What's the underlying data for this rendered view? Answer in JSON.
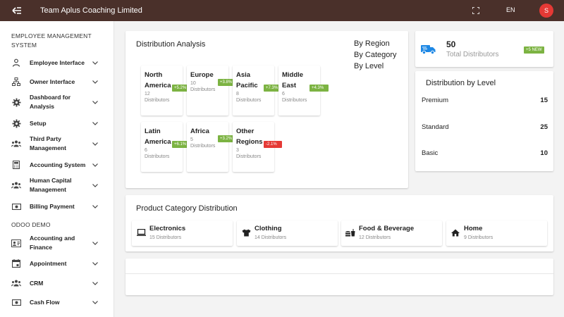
{
  "header": {
    "title": "Team Aplus Coaching Limited",
    "language": "EN",
    "avatar_initial": "S"
  },
  "sidebar": {
    "section1": "EMPLOYEE MANAGEMENT SYSTEM",
    "items1": [
      {
        "label": "Employee Interface",
        "icon": "person-icon"
      },
      {
        "label": "Owner Interface",
        "icon": "org-chart-icon"
      },
      {
        "label": "Dashboard for Analysis",
        "icon": "gear-icon"
      },
      {
        "label": "Setup",
        "icon": "gear-icon"
      },
      {
        "label": "Third Party Management",
        "icon": "group-icon"
      },
      {
        "label": "Accounting System",
        "icon": "calculator-icon"
      },
      {
        "label": "Human Capital Management",
        "icon": "group-icon"
      },
      {
        "label": "Billing Payment",
        "icon": "money-icon"
      }
    ],
    "section2": "ODOO DEMO",
    "items2": [
      {
        "label": "Accounting and Finance",
        "icon": "contact-card-icon"
      },
      {
        "label": "Appointment",
        "icon": "calendar-icon"
      },
      {
        "label": "CRM",
        "icon": "group-icon"
      },
      {
        "label": "Cash Flow",
        "icon": "money-icon"
      }
    ]
  },
  "distribution": {
    "title": "Distribution Analysis",
    "views": [
      "By Region",
      "By Category",
      "By Level"
    ],
    "regions": [
      {
        "name": "North America",
        "count": "12 Distributors",
        "badge": "+5.2%",
        "trend": "up"
      },
      {
        "name": "Europe",
        "count": "10 Distributors",
        "badge": "+3.8%",
        "trend": "up"
      },
      {
        "name": "Asia Pacific",
        "count": "8 Distributors",
        "badge": "+7.3%",
        "trend": "up"
      },
      {
        "name": "Middle East",
        "count": "6 Distributors",
        "badge": "+4.3%",
        "trend": "up"
      },
      {
        "name": "Latin America",
        "count": "6 Distributors",
        "badge": "+6.1%",
        "trend": "up"
      },
      {
        "name": "Africa",
        "count": "5 Distributors",
        "badge": "+3.2%",
        "trend": "up"
      },
      {
        "name": "Other Regions",
        "count": "3 Distributors",
        "badge": "-2.1%",
        "trend": "down"
      }
    ]
  },
  "total": {
    "value": "50",
    "label": "Total Distributors",
    "badge": "+5 NEW",
    "icon": "truck-icon"
  },
  "levels": {
    "title": "Distribution by Level",
    "rows": [
      {
        "name": "Premium",
        "value": "15"
      },
      {
        "name": "Standard",
        "value": "25"
      },
      {
        "name": "Basic",
        "value": "10"
      }
    ]
  },
  "categories": {
    "title": "Product Category Distribution",
    "items": [
      {
        "name": "Electronics",
        "count": "15 Distributors",
        "icon": "laptop-icon"
      },
      {
        "name": "Clothing",
        "count": "14 Distributors",
        "icon": "shirt-icon"
      },
      {
        "name": "Food & Beverage",
        "count": "12 Distributors",
        "icon": "food-icon"
      },
      {
        "name": "Home",
        "count": "9 Distributors",
        "icon": "home-icon"
      }
    ]
  },
  "colors": {
    "topbar": "#4a302a",
    "avatar": "#e53935",
    "badge_up": "#7cb342",
    "badge_down": "#e53935",
    "truck": "#1e88e5"
  }
}
